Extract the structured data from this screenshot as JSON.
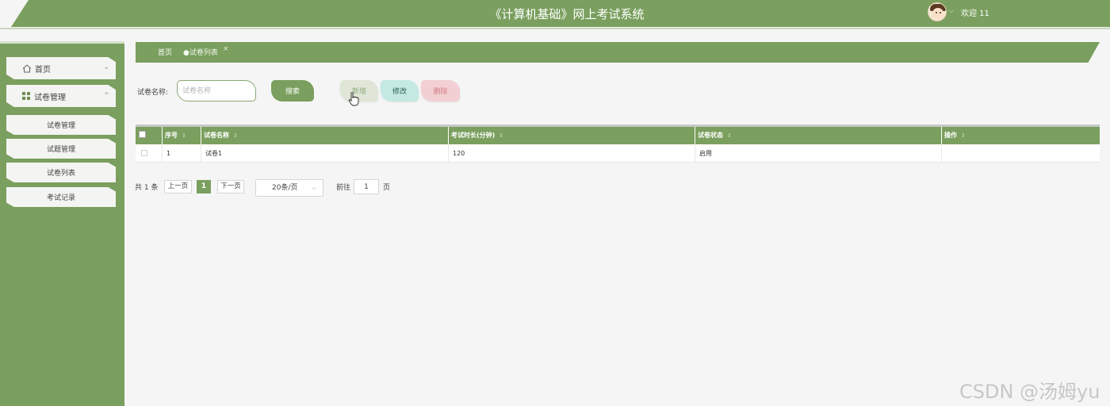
{
  "header": {
    "title": "《计算机基础》网上考试系统",
    "welcome": "欢迎 11"
  },
  "sidebar": {
    "items": [
      {
        "label": "首页",
        "icon": "home-icon"
      },
      {
        "label": "试卷管理",
        "icon": "grid-icon"
      }
    ],
    "subitems": [
      "试卷管理",
      "试题管理",
      "试卷列表",
      "考试记录"
    ]
  },
  "tabs": {
    "home": "首页",
    "current": "试卷列表"
  },
  "search": {
    "label": "试卷名称:",
    "placeholder": "试卷名称",
    "button": "搜索"
  },
  "actions": {
    "add": "新增",
    "edit": "修改",
    "delete": "删除"
  },
  "table": {
    "columns": [
      "序号",
      "试卷名称",
      "考试时长(分钟)",
      "试卷状态",
      "操作"
    ],
    "rows": [
      {
        "index": "1",
        "name": "试卷1",
        "duration": "120",
        "status": "启用",
        "ops": ""
      }
    ]
  },
  "pagination": {
    "total": "共 1 条",
    "prev": "上一页",
    "current": "1",
    "next": "下一页",
    "page_size": "20条/页",
    "goto_label": "前往",
    "goto_value": "1",
    "page_suffix": "页"
  },
  "watermark": "CSDN @汤姆yu",
  "colors": {
    "primary": "#7a9f5e",
    "background": "#f5f5f5",
    "edit_button": "#c3e9e2",
    "delete_button": "#f2cfd3"
  }
}
